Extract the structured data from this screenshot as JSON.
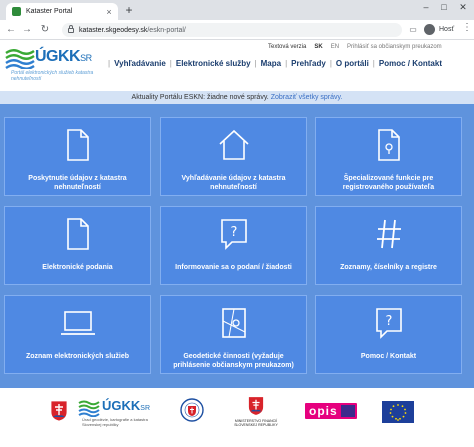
{
  "browser": {
    "tab_title": "Kataster Portal",
    "tab_close": "×",
    "new_tab": "+",
    "url_host": "kataster.skgeodesy.sk",
    "url_path": "/eskn-portal/",
    "profile": "Hosť",
    "minimize": "–",
    "maximize": "□",
    "close": "✕"
  },
  "header": {
    "logo_text": "ÚGKK",
    "logo_suffix": "SR",
    "logo_sub": "Portál elektronických služieb katastra nehnuteľností",
    "toplinks": {
      "text_version": "Textová verzia",
      "lang_sk": "SK",
      "lang_en": "EN",
      "login": "Prihlásiť sa občianskym preukazom"
    },
    "nav": [
      "Vyhľadávanie",
      "Elektronické služby",
      "Mapa",
      "Prehľady",
      "O portáli",
      "Pomoc / Kontakt"
    ]
  },
  "news": {
    "text": "Aktuality Portálu ESKN: žiadne nové správy.",
    "link": "Zobraziť všetky správy."
  },
  "tiles": [
    {
      "label": "Poskytnutie údajov z katastra nehnuteľností",
      "icon": "document-icon"
    },
    {
      "label": "Vyhľadávanie údajov z katastra nehnuteľností",
      "icon": "house-icon"
    },
    {
      "label": "Špecializované funkcie pre registrovaného používateľa",
      "icon": "document-map-icon"
    },
    {
      "label": "Elektronické podania",
      "icon": "document-icon"
    },
    {
      "label": "Informovanie sa o podaní / žiadosti",
      "icon": "question-bubble-icon"
    },
    {
      "label": "Zoznamy, číselníky a registre",
      "icon": "hash-icon"
    },
    {
      "label": "Zoznam elektronických služieb",
      "icon": "laptop-icon"
    },
    {
      "label": "Geodetické činnosti (vyžaduje prihlásenie občianskym preukazom)",
      "icon": "map-pin-icon"
    },
    {
      "label": "Pomoc / Kontakt",
      "icon": "question-bubble-icon"
    }
  ],
  "footer": {
    "ugkk_text": "ÚGKK",
    "ugkk_suffix": "SR",
    "ugkk_sub": "Úrad geodézie, kartografie a katastra Slovenskej republiky",
    "ministry_text": "MINISTERSTVO FINANCIÍ SLOVENSKEJ REPUBLIKY",
    "opis_text": "opis"
  },
  "colors": {
    "tile_bg": "#4f89e3",
    "area_bg": "#5f93dd",
    "nav_text": "#1a3d6e",
    "brand_blue": "#1d6fb8",
    "brand_green": "#3aa935"
  }
}
